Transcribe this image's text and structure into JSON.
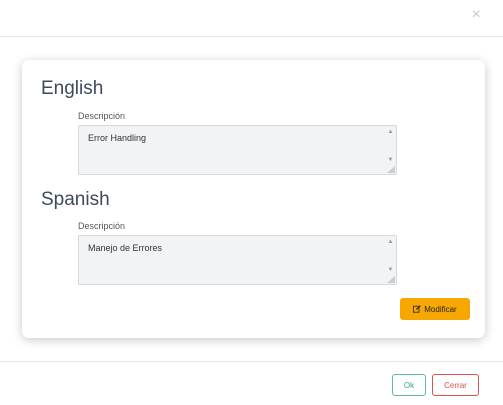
{
  "header": {
    "close_symbol": "×"
  },
  "sections": [
    {
      "title": "English",
      "field_label": "Descripción",
      "value": "Error Handling"
    },
    {
      "title": "Spanish",
      "field_label": "Descripción",
      "value": "Manejo de Errores"
    }
  ],
  "actions": {
    "modify_label": "Modificar",
    "modify_icon": "edit-icon",
    "modify_color": "#f7a800"
  },
  "footer": {
    "ok_label": "Ok",
    "close_label": "Cerrar",
    "ok_color": "#5cbf95",
    "close_color": "#d9534f"
  }
}
